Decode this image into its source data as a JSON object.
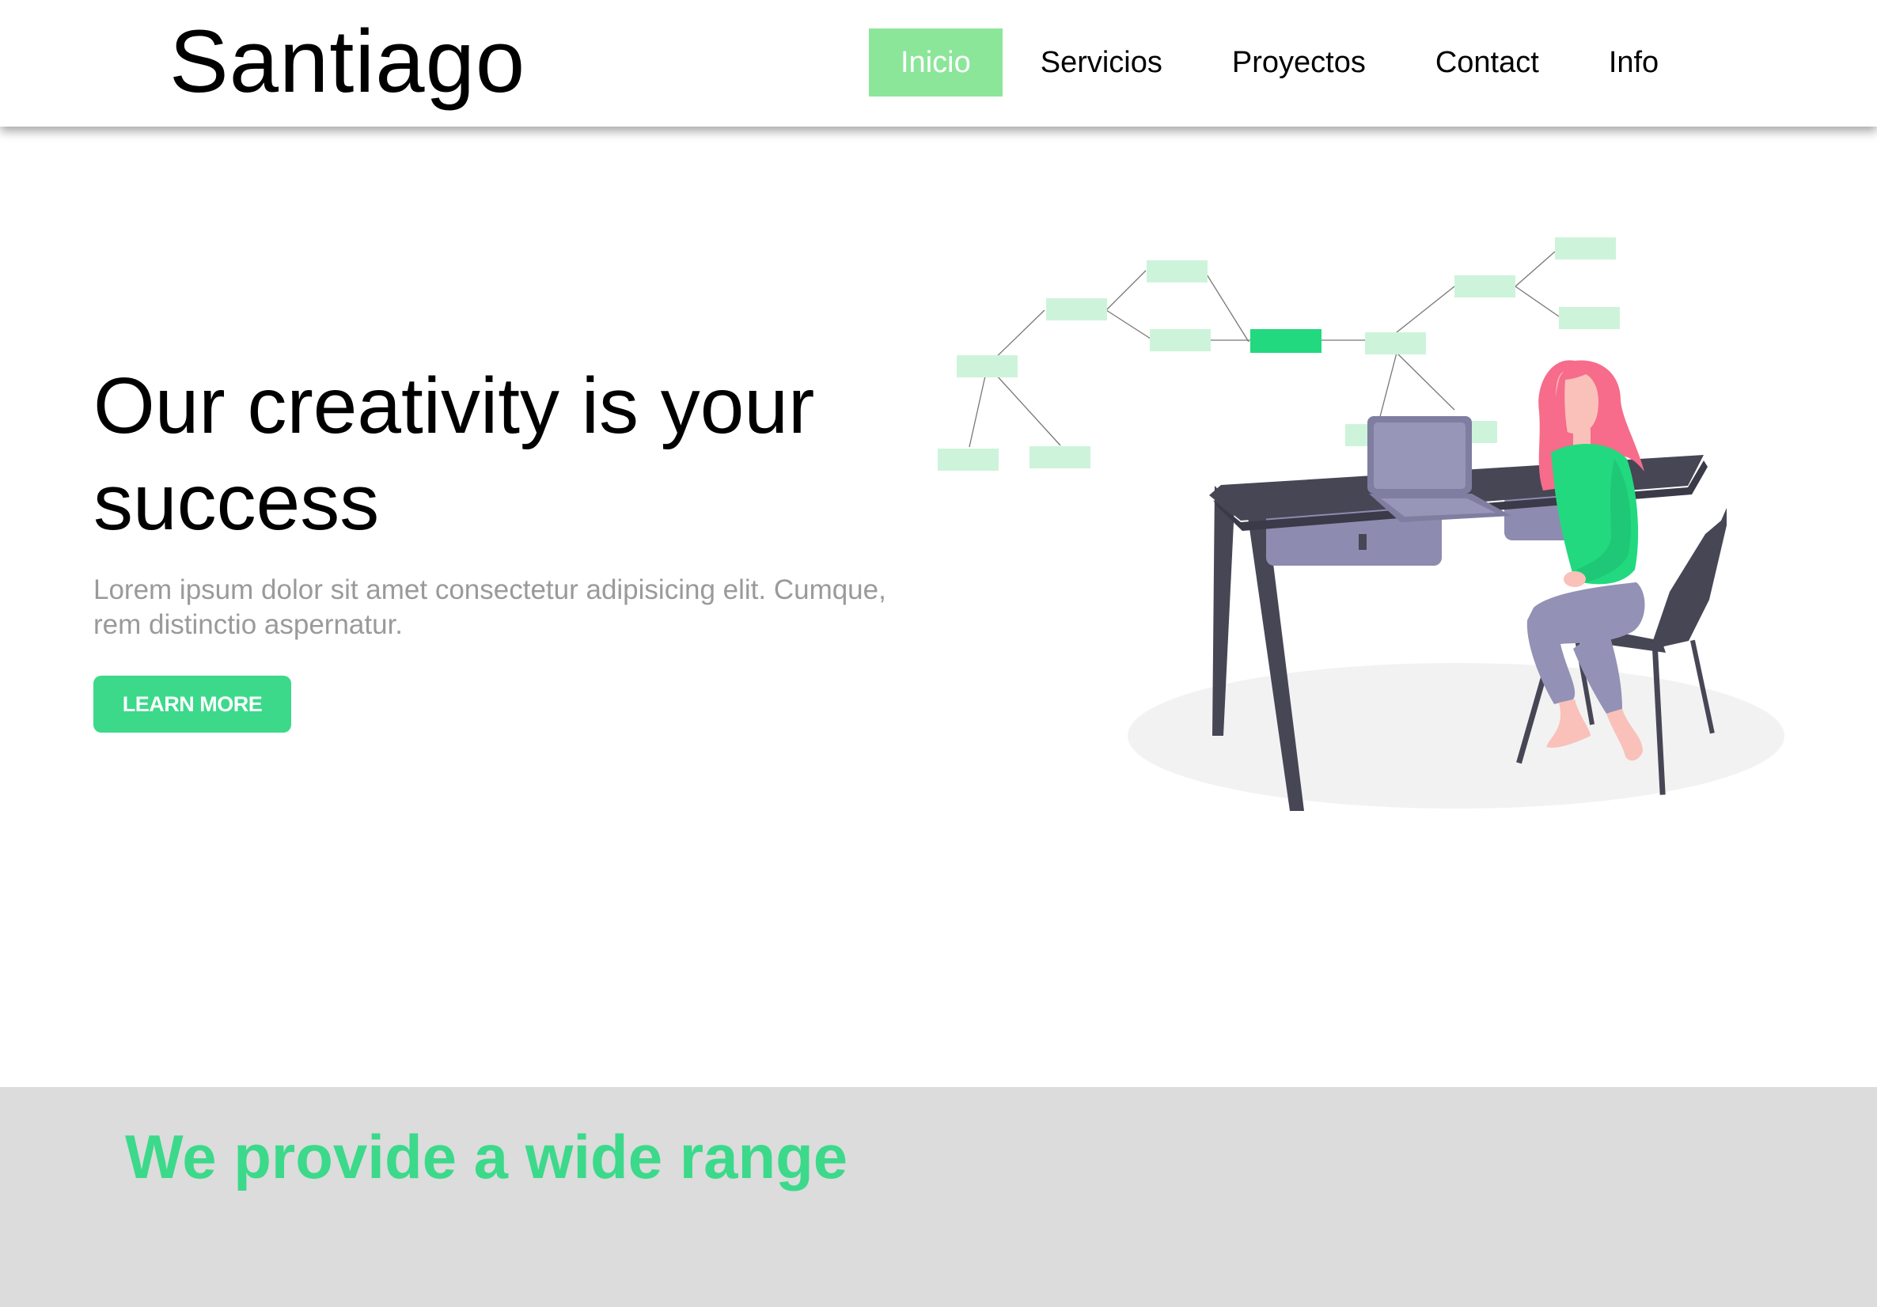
{
  "header": {
    "brand": "Santiago",
    "nav": [
      {
        "label": "Inicio",
        "active": true
      },
      {
        "label": "Servicios",
        "active": false
      },
      {
        "label": "Proyectos",
        "active": false
      },
      {
        "label": "Contact",
        "active": false
      },
      {
        "label": "Info",
        "active": false
      }
    ]
  },
  "hero": {
    "title": "Our creativity is your success",
    "text": "Lorem ipsum dolor sit amet consectetur adipisicing elit. Cumque, rem distinctio aspernatur.",
    "button_label": "LEARN MORE",
    "illustration_name": "woman-at-desk-mindmap-illustration"
  },
  "services": {
    "title": "We provide a wide range"
  },
  "colors": {
    "accent": "#3cd98b",
    "nav_active_bg": "#8ce69a",
    "services_bg": "#dcdcdc",
    "muted_text": "#9a9a9a"
  }
}
